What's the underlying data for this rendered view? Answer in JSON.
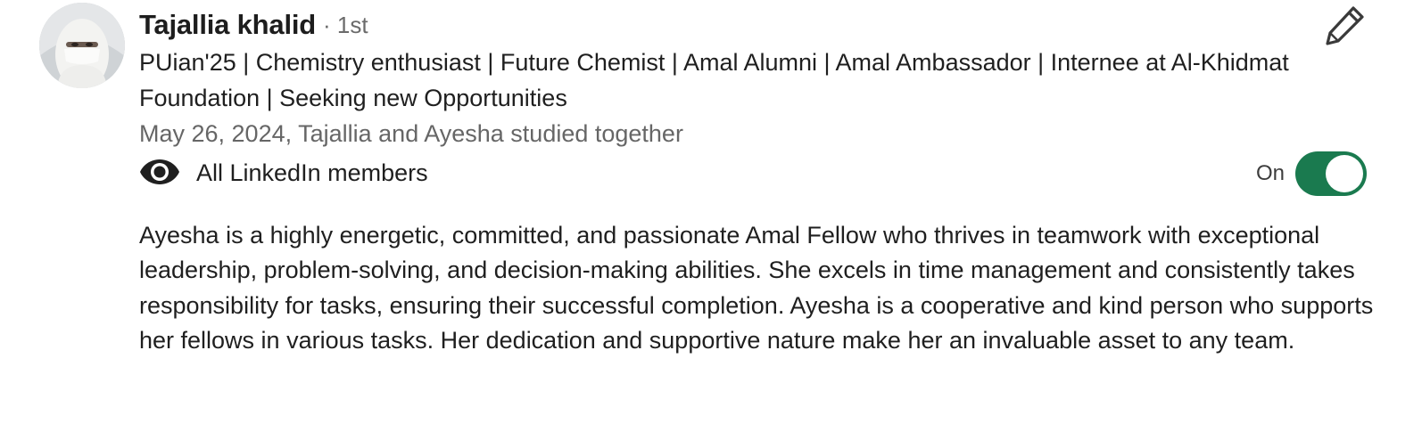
{
  "recommender": {
    "name": "Tajallia khalid",
    "connection_degree": "· 1st",
    "headline": "PUian'25 | Chemistry enthusiast | Future Chemist | Amal Alumni | Amal Ambassador | Internee at Al-Khidmat Foundation | Seeking new Opportunities",
    "relationship": "May 26, 2024, Tajallia and Ayesha studied together"
  },
  "visibility": {
    "icon": "eye-icon",
    "label": "All LinkedIn members",
    "toggle_label": "On",
    "toggle_on": true,
    "toggle_color": "#1a7a4f"
  },
  "recommendation_text": "Ayesha is a highly energetic, committed, and passionate Amal Fellow who thrives in teamwork with exceptional leadership, problem-solving, and decision-making abilities. She excels in time management and consistently takes responsibility for tasks, ensuring their successful completion. Ayesha is a cooperative and kind person who supports her fellows in various tasks. Her dedication and supportive nature make her an invaluable asset to any team.",
  "actions": {
    "edit_icon": "pencil-icon"
  }
}
